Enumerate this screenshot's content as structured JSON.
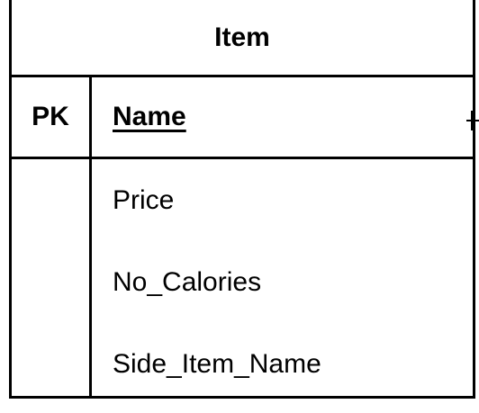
{
  "entity": {
    "title": "Item",
    "primary_key": {
      "key_label": "PK",
      "attribute": "Name"
    },
    "attributes": [
      "Price",
      "No_Calories",
      "Side_Item_Name"
    ]
  }
}
